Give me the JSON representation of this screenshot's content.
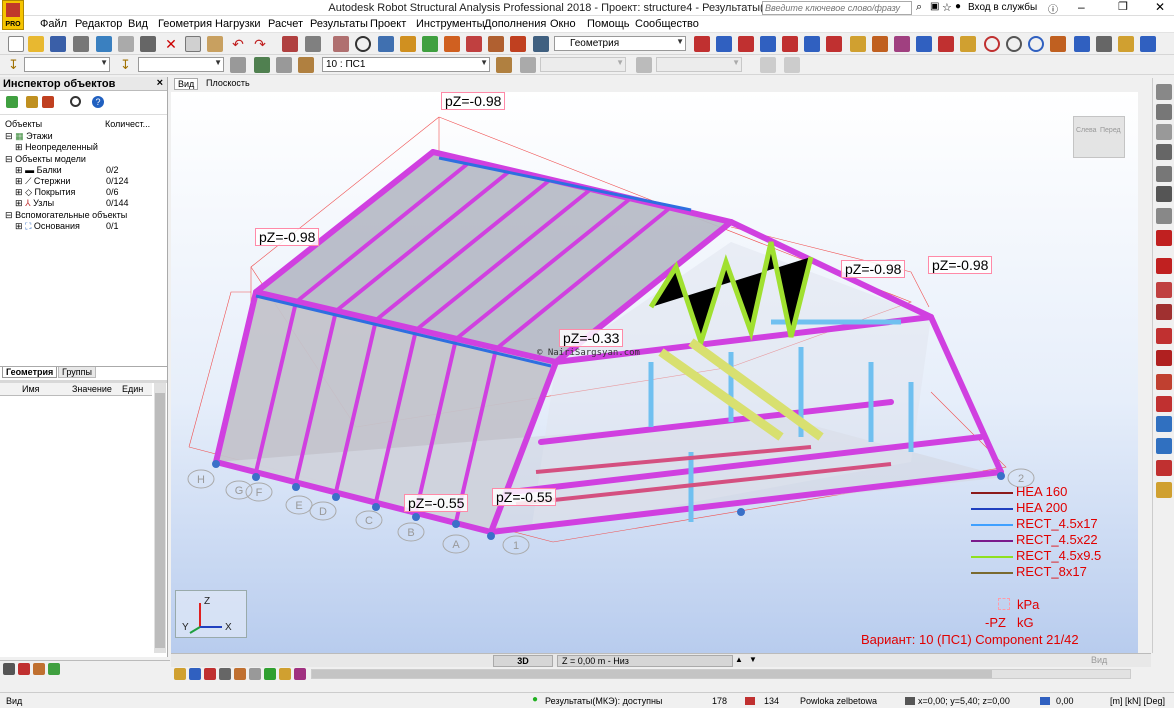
{
  "window": {
    "title": "Autodesk Robot Structural Analysis Professional 2018 - Проект: structure4 - Результаты(МКЭ): доступны",
    "search_placeholder": "Введите ключевое слово/фразу",
    "login": "Вход в службы"
  },
  "app_badge": "PRO",
  "menu": [
    "Файл",
    "Редактор",
    "Вид",
    "Геометрия",
    "Нагрузки",
    "Расчет",
    "Результаты",
    "Проект",
    "Инструменты",
    "Дополнения",
    "Окно",
    "Помощь",
    "Сообщество"
  ],
  "toolbar": {
    "layout_combo": "Геометрия",
    "load_case_combo": "10 : ПС1"
  },
  "inspector": {
    "title": "Инспектор объектов",
    "col_objects": "Объекты",
    "col_count": "Количест...",
    "tree": [
      {
        "label": "Этажи",
        "value": ""
      },
      {
        "label": "Неопределенный",
        "value": ""
      },
      {
        "label": "Объекты модели",
        "value": ""
      },
      {
        "label": "Балки",
        "value": "0/2"
      },
      {
        "label": "Стержни",
        "value": "0/124"
      },
      {
        "label": "Покрытия",
        "value": "0/6"
      },
      {
        "label": "Узлы",
        "value": "0/144"
      },
      {
        "label": "Вспомогательные объекты",
        "value": ""
      },
      {
        "label": "Основания",
        "value": "0/1"
      }
    ],
    "tabs": [
      "Геометрия",
      "Группы"
    ],
    "prop_headers": [
      "Имя",
      "Значение",
      "Един"
    ]
  },
  "viewport": {
    "tabs": [
      "Вид",
      "Плоскость"
    ],
    "watermark": "© NairiSargsyan.com",
    "load_labels": [
      "pZ=-0.98",
      "pZ=-0.98",
      "pZ=-0.98",
      "pZ=-0.98",
      "pZ=-0.33",
      "pZ=-0.55",
      "pZ=-0.55"
    ],
    "grid_letters": [
      "H",
      "G",
      "F",
      "E",
      "D",
      "C",
      "B",
      "A",
      "1",
      "2"
    ],
    "viewcube_left": "Слева",
    "viewcube_front": "Перед",
    "axes": {
      "x": "X",
      "y": "Y",
      "z": "Z"
    },
    "mode_3d": "3D",
    "z_level": "Z = 0,00 m - Низ",
    "view_label": "Вид"
  },
  "legend": {
    "sections": [
      {
        "name": "HEA 160",
        "color": "#8b1a1a"
      },
      {
        "name": "HEA 200",
        "color": "#1f3fbf"
      },
      {
        "name": "RECT_4.5x17",
        "color": "#3fa0ff"
      },
      {
        "name": "RECT_4.5x22",
        "color": "#7a1a8c"
      },
      {
        "name": "RECT_4.5x9.5",
        "color": "#8fe020"
      },
      {
        "name": "RECT_8x17",
        "color": "#7a6a30"
      }
    ],
    "unit_pressure": "kPa",
    "load_dir": "-PZ",
    "unit_force": "kG",
    "variant": "Вариант: 10 (ПС1) Component 21/42"
  },
  "status": {
    "left_label": "Вид",
    "results": "Результаты(МКЭ): доступны",
    "nodes": "178",
    "bars": "134",
    "panel": "Powloka zelbetowa",
    "coords": "x=0,00; y=5,40; z=0,00",
    "angle": "0,00",
    "units": "[m] [kN] [Deg]"
  }
}
